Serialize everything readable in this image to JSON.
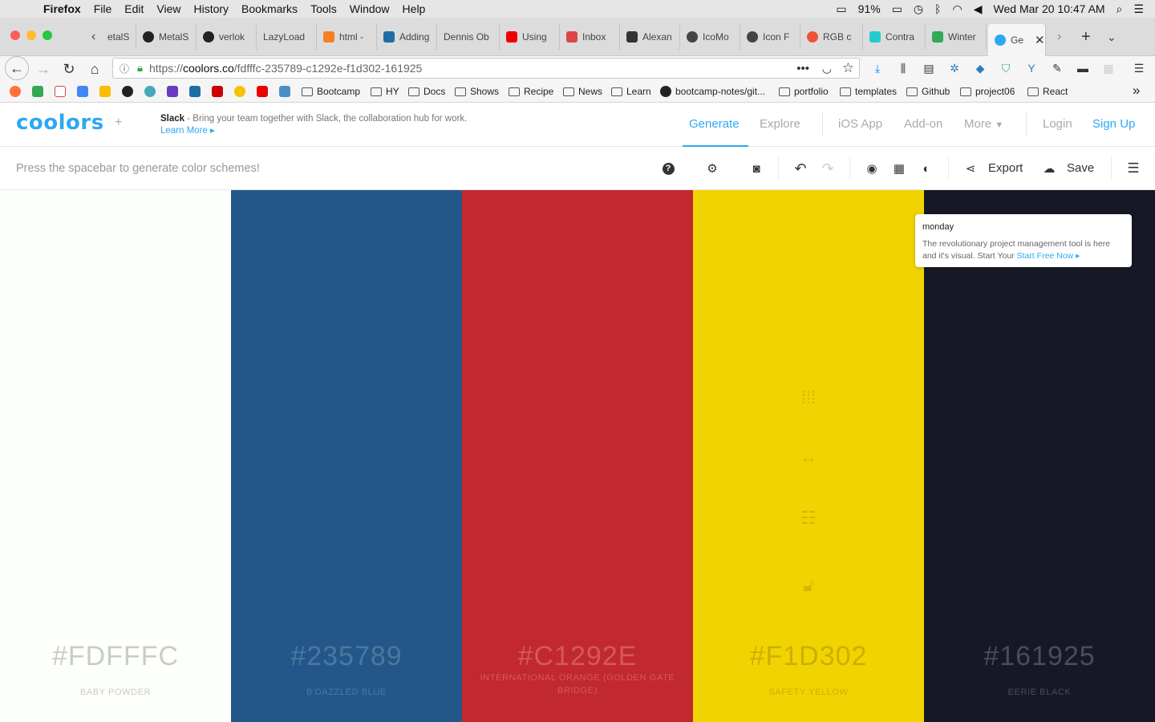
{
  "menubar": {
    "app": "Firefox",
    "items": [
      "File",
      "Edit",
      "View",
      "History",
      "Bookmarks",
      "Tools",
      "Window",
      "Help"
    ],
    "battery": "91%",
    "datetime": "Wed Mar 20  10:47 AM"
  },
  "tabs": [
    {
      "label": "etalS",
      "color": "#888"
    },
    {
      "label": "MetalS",
      "color": "#222"
    },
    {
      "label": "verlok",
      "color": "#222"
    },
    {
      "label": "LazyLoad",
      "color": "#ccc"
    },
    {
      "label": "html -",
      "color": "#f48024"
    },
    {
      "label": "Adding",
      "color": "#1d6fa5"
    },
    {
      "label": "Dennis Ob",
      "color": "#ccc"
    },
    {
      "label": "Using",
      "color": "#e00"
    },
    {
      "label": "Inbox",
      "color": "#d44"
    },
    {
      "label": "Alexan",
      "color": "#333"
    },
    {
      "label": "IcoMo",
      "color": "#444"
    },
    {
      "label": "Icon F",
      "color": "#444"
    },
    {
      "label": "RGB c",
      "color": "#e53"
    },
    {
      "label": "Contra",
      "color": "#2cc"
    },
    {
      "label": "Winter",
      "color": "#3a5"
    },
    {
      "label": "Ge",
      "color": "#2ea8f2"
    }
  ],
  "urlbar": {
    "prefix": "https://",
    "domain": "coolors.co",
    "path": "/fdfffc-235789-c1292e-f1d302-161925"
  },
  "bookmarks": {
    "folders": [
      "Bootcamp",
      "HY",
      "Docs",
      "Shows",
      "Recipe",
      "News",
      "Learn"
    ],
    "github_link": "bootcamp-notes/git...",
    "folders2": [
      "portfolio",
      "templates",
      "Github",
      "project06",
      "React"
    ]
  },
  "header": {
    "logo": "coolors",
    "plus": "+",
    "ad_brand": "Slack",
    "ad_text": " - Bring your team together with Slack, the collaboration hub for work.",
    "ad_link": "Learn More  ▸",
    "nav": [
      "Generate",
      "Explore",
      "iOS App",
      "Add-on",
      "More"
    ],
    "login": "Login",
    "signup": "Sign Up"
  },
  "toolbar": {
    "hint": "Press the spacebar to generate color schemes!",
    "export": "Export",
    "save": "Save"
  },
  "palette": [
    {
      "hex": "#FDFFFC",
      "name": "BABY POWDER",
      "bg": "#FDFFFC",
      "text": "#c9cbc8"
    },
    {
      "hex": "#235789",
      "name": "B'DAZZLED BLUE",
      "bg": "#235789",
      "text": "#4c77a0"
    },
    {
      "hex": "#C1292E",
      "name": "INTERNATIONAL ORANGE (GOLDEN GATE BRIDGE)",
      "bg": "#C1292E",
      "text": "#d6585c"
    },
    {
      "hex": "#F1D302",
      "name": "SAFETY YELLOW",
      "bg": "#F1D302",
      "text": "#c9b002"
    },
    {
      "hex": "#161925",
      "name": "EERIE BLACK",
      "bg": "#161925",
      "text": "#4a4d58"
    }
  ],
  "popup": {
    "title": "monday",
    "text": "The revolutionary project management tool is here and it's visual. Start Your ",
    "link": "Start Free Now  ▸"
  }
}
